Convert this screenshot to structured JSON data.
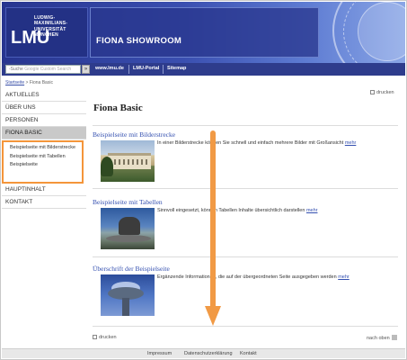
{
  "header": {
    "logo_mark": "LMU",
    "logo_lines": [
      "LUDWIG-",
      "MAXIMILIANS-",
      "UNIVERSITÄT",
      "MÜNCHEN"
    ],
    "site_title": "FIONA SHOWROOM"
  },
  "navbar": {
    "search_placeholder": "-Suche",
    "search_hint": "Google Custom Search",
    "search_button_icon": "search-icon",
    "links": [
      "www.lmu.de",
      "LMU-Portal",
      "Sitemap"
    ]
  },
  "breadcrumb": {
    "home": "Startseite",
    "separator": ">",
    "current": "Fiona Basic"
  },
  "sidebar": {
    "items": [
      "AKTUELLES",
      "ÜBER UNS",
      "PERSONEN",
      "FIONA BASIC"
    ],
    "subitems": [
      "Beispielseite mit Bilderstrecke",
      "Beispielseite mit Tabellen",
      "Beispielseite"
    ],
    "items_after": [
      "HAUPTINHALT",
      "KONTAKT"
    ]
  },
  "main": {
    "print_label": "drucken",
    "title": "Fiona Basic",
    "sections": [
      {
        "title": "Beispielseite mit Bilderstrecke",
        "text": "In einer Bilderstrecke können Sie schnell und einfach mehrere Bilder mit Großansicht",
        "more": "mehr"
      },
      {
        "title": "Beispielseite mit Tabellen",
        "text": "Sinnvoll eingesetzt, können Tabellen Inhalte übersichtlich darstellen",
        "more": "mehr"
      },
      {
        "title": "Überschrift der Beispielseite",
        "text": "Ergänzende Informationen, die auf der übergeordneten Seite ausgegeben werden",
        "more": "mehr"
      }
    ],
    "print_bottom": "drucken",
    "to_top": "nach oben"
  },
  "footer": {
    "links": [
      "Impressum",
      "Datenschutzerklärung",
      "Kontakt"
    ]
  },
  "colors": {
    "header_blue": "#27358f",
    "link_blue": "#3450b0",
    "highlight_orange": "#f19a45"
  }
}
